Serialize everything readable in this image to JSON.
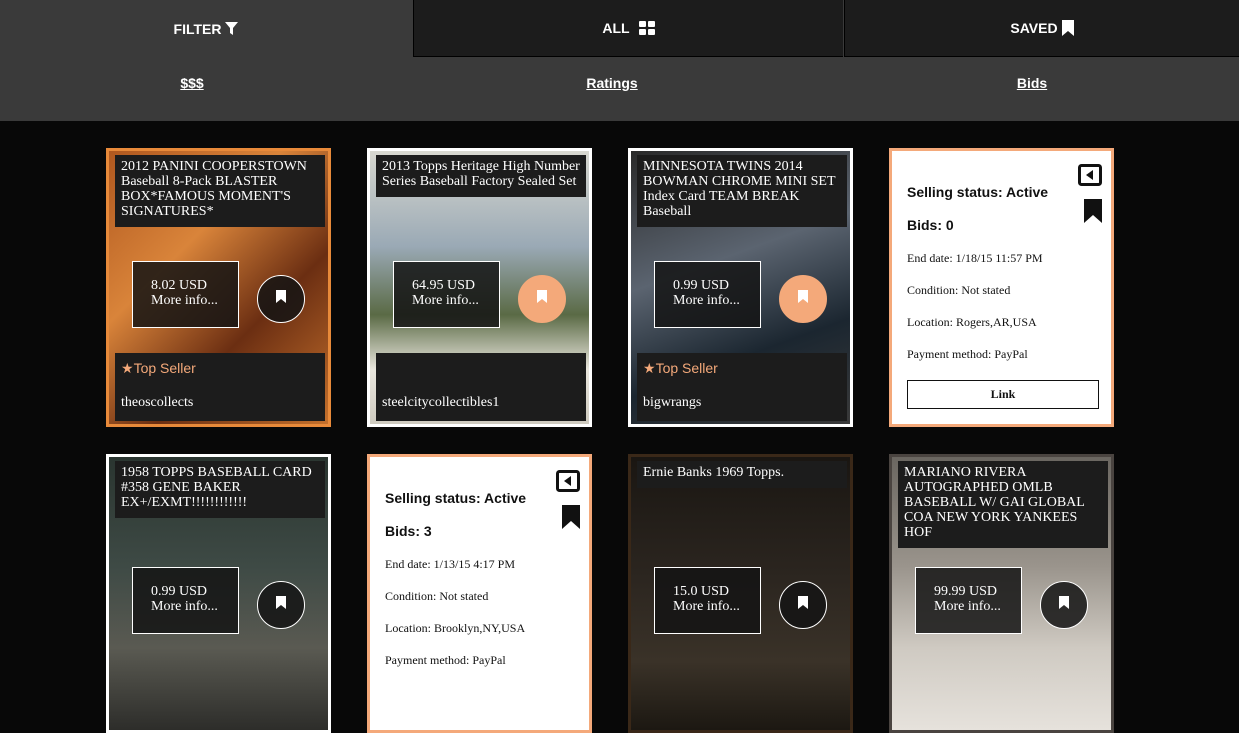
{
  "tabs": {
    "filter": "FILTER",
    "all": "ALL",
    "saved": "SAVED"
  },
  "sort": {
    "price": "$$$",
    "ratings": "Ratings",
    "bids": "Bids"
  },
  "cards": [
    {
      "title": "2012 PANINI COOPERSTOWN Baseball 8-Pack BLASTER BOX*FAMOUS MOMENT'S SIGNATURES*",
      "price": "8.02 USD",
      "more": "More info...",
      "badge": "Top Seller",
      "seller": "theoscollects"
    },
    {
      "title": "2013 Topps Heritage High Number Series Baseball Factory Sealed Set",
      "price": "64.95 USD",
      "more": "More info...",
      "seller": "steelcitycollectibles1"
    },
    {
      "title": "MINNESOTA TWINS 2014 BOWMAN CHROME MINI SET Index Card TEAM BREAK Baseball",
      "price": "0.99 USD",
      "more": "More info...",
      "badge": "Top Seller",
      "seller": "bigwrangs"
    },
    {
      "status": "Selling status: Active",
      "bids": "Bids: 0",
      "end": "End date: 1/18/15 11:57 PM",
      "condition": "Condition: Not stated",
      "location": "Location: Rogers,AR,USA",
      "payment": "Payment method: PayPal",
      "link": "Link"
    },
    {
      "title": "1958 TOPPS BASEBALL CARD #358 GENE BAKER EX+/EXMT!!!!!!!!!!!!",
      "price": "0.99 USD",
      "more": "More info..."
    },
    {
      "status": "Selling status: Active",
      "bids": "Bids: 3",
      "end": "End date: 1/13/15 4:17 PM",
      "condition": "Condition: Not stated",
      "location": "Location: Brooklyn,NY,USA",
      "payment": "Payment method: PayPal"
    },
    {
      "title": "Ernie Banks 1969 Topps.",
      "price": "15.0 USD",
      "more": "More info..."
    },
    {
      "title": "MARIANO RIVERA AUTOGRAPHED OMLB BASEBALL W/ GAI GLOBAL COA NEW YORK YANKEES HOF",
      "price": "99.99 USD",
      "more": "More info..."
    }
  ]
}
